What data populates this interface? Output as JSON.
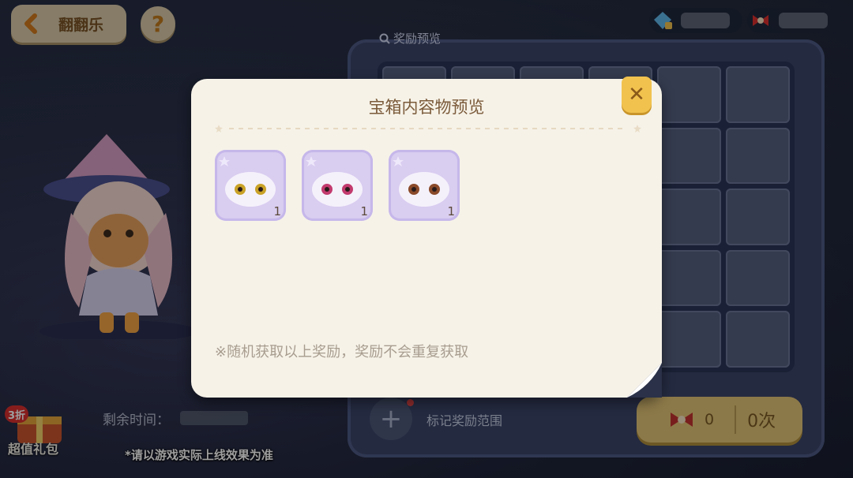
{
  "header": {
    "back_label": "翻翻乐",
    "help_label": "?"
  },
  "board": {
    "title": "奖励预览",
    "mark_label": "标记奖励范围",
    "bow_count": "0",
    "times_label": "0次"
  },
  "left_panel": {
    "timer_label": "剩余时间：",
    "gift_badge": "3折",
    "gift_label": "超值礼包"
  },
  "disclaimer": "*请以游戏实际上线效果为准",
  "modal": {
    "title": "宝箱内容物预览",
    "close_label": "✕",
    "items": [
      {
        "qty": "1",
        "eye_color": "#c9a227"
      },
      {
        "qty": "1",
        "eye_color": "#c23a6e"
      },
      {
        "qty": "1",
        "eye_color": "#8a4a2a"
      }
    ],
    "note": "※随机获取以上奖励，奖励不会重复获取"
  },
  "colors": {
    "modal_bg": "#f6f2e8",
    "close_button": "#f1c24e",
    "item_bg": "#d9cdf0"
  }
}
